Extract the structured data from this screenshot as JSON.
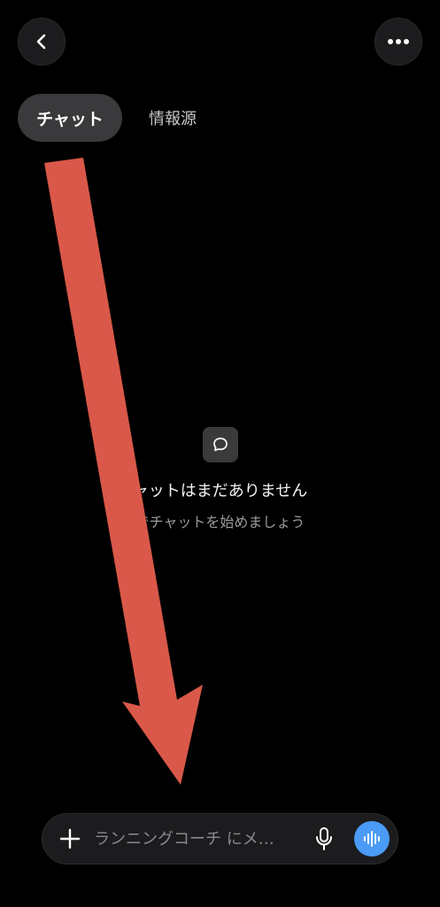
{
  "header": {
    "back_icon": "chevron-left-icon",
    "more_icon": "ellipsis-icon"
  },
  "tabs": [
    {
      "label": "チャット",
      "active": true
    },
    {
      "label": "情報源",
      "active": false
    }
  ],
  "empty_state": {
    "icon": "chat-bubble-icon",
    "title": "ャットはまだありません",
    "subtitle": "でチャットを始めましょう"
  },
  "composer": {
    "placeholder": "ランニングコーチ にメ…",
    "plus_icon": "plus-icon",
    "mic_icon": "microphone-icon",
    "voice_icon": "voice-waveform-icon",
    "voice_color": "#4a9bf5"
  },
  "overlay": {
    "arrow_color": "#d9584a"
  }
}
